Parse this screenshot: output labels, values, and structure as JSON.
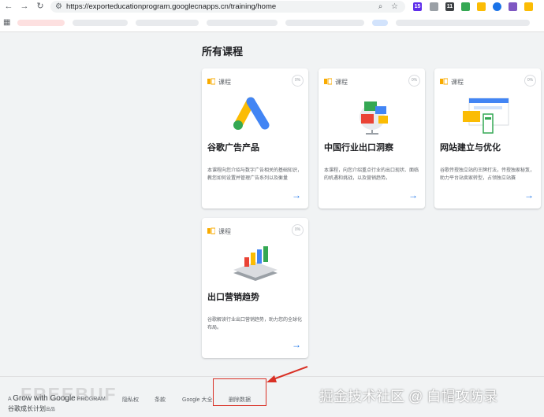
{
  "browser": {
    "url": "https://exporteducationprogram.googlecnapps.cn/training/home",
    "back_icon": "arrow-left-icon",
    "forward_icon": "arrow-right-icon",
    "reload_icon": "reload-icon",
    "extension_badges": [
      "15",
      "11"
    ]
  },
  "page": {
    "section_title": "所有课程"
  },
  "courses": [
    {
      "badge": "课程",
      "progress": "0%",
      "title": "谷歌广告产品",
      "desc": "本课程向您介绍与数字广告相关的基础知识，教您如何设置并管理广告系列以及衡量"
    },
    {
      "badge": "课程",
      "progress": "0%",
      "title": "中国行业出口洞察",
      "desc": "本课程，向您介绍重点行业的出口现状、面临的机遇和挑战，以及营销趋势。"
    },
    {
      "badge": "课程",
      "progress": "0%",
      "title": "网站建立与优化",
      "desc": "谷歌传授独立站的王牌打法，传授独家秘笈，助力平台站卖家转型，占领独立站赛"
    },
    {
      "badge": "课程",
      "progress": "0%",
      "title": "出口营销趋势",
      "desc": "谷歌解读行业出口营销趋势，助力您的全球化布局。"
    }
  ],
  "footer": {
    "brand_prefix": "A",
    "brand_main": "Grow with Google",
    "brand_suffix": "PROGRAM",
    "brand_cn": "谷歌成长计划",
    "brand_cn_suffix": "出品",
    "links": [
      "隐私权",
      "条款",
      "Google 大全",
      "删除数据"
    ]
  },
  "watermarks": {
    "left": "FREEBUF",
    "right": "掘金技术社区 @ 白帽攻防录"
  },
  "colors": {
    "accent": "#1a73e8",
    "highlight": "#d93025",
    "badge_yellow": "#f9ab00"
  }
}
